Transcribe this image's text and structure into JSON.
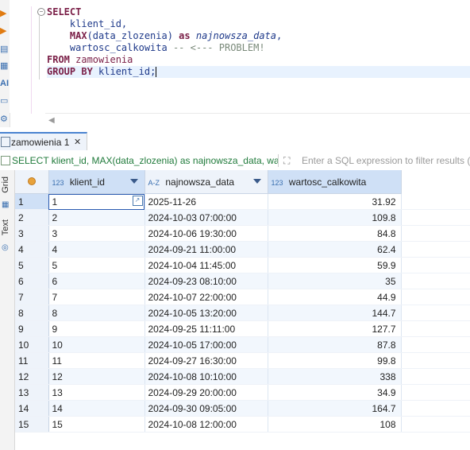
{
  "editor": {
    "lines": [
      [
        {
          "t": "SELECT",
          "c": "kw"
        }
      ],
      [
        {
          "t": "    klient_id,",
          "c": "id"
        }
      ],
      [
        {
          "t": "    MAX",
          "c": "kw"
        },
        {
          "t": "(data_zlozenia) ",
          "c": "id"
        },
        {
          "t": "as ",
          "c": "kw"
        },
        {
          "t": "najnowsza_data",
          "c": "it"
        },
        {
          "t": ",",
          "c": "id"
        }
      ],
      [
        {
          "t": "    wartosc_calkowita ",
          "c": "id"
        },
        {
          "t": "-- <--- PROBLEM!",
          "c": "cm"
        }
      ],
      [
        {
          "t": "FROM ",
          "c": "kw"
        },
        {
          "t": "zamowienia",
          "c": "sc"
        }
      ],
      [
        {
          "t": "GROUP BY ",
          "c": "kw"
        },
        {
          "t": "klient_id",
          "c": "id"
        },
        {
          "t": ";",
          "c": "id"
        }
      ]
    ]
  },
  "results_tab": {
    "label": "zamowienia 1",
    "close": "✕"
  },
  "filter": {
    "query": "SELECT klient_id, MAX(data_zlozenia) as najnowsza_data, wartosc",
    "placeholder": "Enter a SQL expression to filter results (us"
  },
  "side_tabs": {
    "grid": "Grid",
    "text": "Text"
  },
  "grid": {
    "columns": [
      {
        "type": "123",
        "name": "klient_id"
      },
      {
        "type": "A-Z",
        "name": "najnowsza_data"
      },
      {
        "type": "123",
        "name": "wartosc_calkowita"
      }
    ],
    "rows": [
      [
        "1",
        "1",
        "2025-11-26",
        "31.92"
      ],
      [
        "2",
        "2",
        "2024-10-03 07:00:00",
        "109.8"
      ],
      [
        "3",
        "3",
        "2024-10-06 19:30:00",
        "84.8"
      ],
      [
        "4",
        "4",
        "2024-09-21 11:00:00",
        "62.4"
      ],
      [
        "5",
        "5",
        "2024-10-04 11:45:00",
        "59.9"
      ],
      [
        "6",
        "6",
        "2024-09-23 08:10:00",
        "35"
      ],
      [
        "7",
        "7",
        "2024-10-07 22:00:00",
        "44.9"
      ],
      [
        "8",
        "8",
        "2024-10-05 13:20:00",
        "144.7"
      ],
      [
        "9",
        "9",
        "2024-09-25 11:11:00",
        "127.7"
      ],
      [
        "10",
        "10",
        "2024-10-05 17:00:00",
        "87.8"
      ],
      [
        "11",
        "11",
        "2024-09-27 16:30:00",
        "99.8"
      ],
      [
        "12",
        "12",
        "2024-10-08 10:10:00",
        "338"
      ],
      [
        "13",
        "13",
        "2024-09-29 20:00:00",
        "34.9"
      ],
      [
        "14",
        "14",
        "2024-09-30 09:05:00",
        "164.7"
      ],
      [
        "15",
        "15",
        "2024-10-08 12:00:00",
        "108"
      ]
    ]
  }
}
